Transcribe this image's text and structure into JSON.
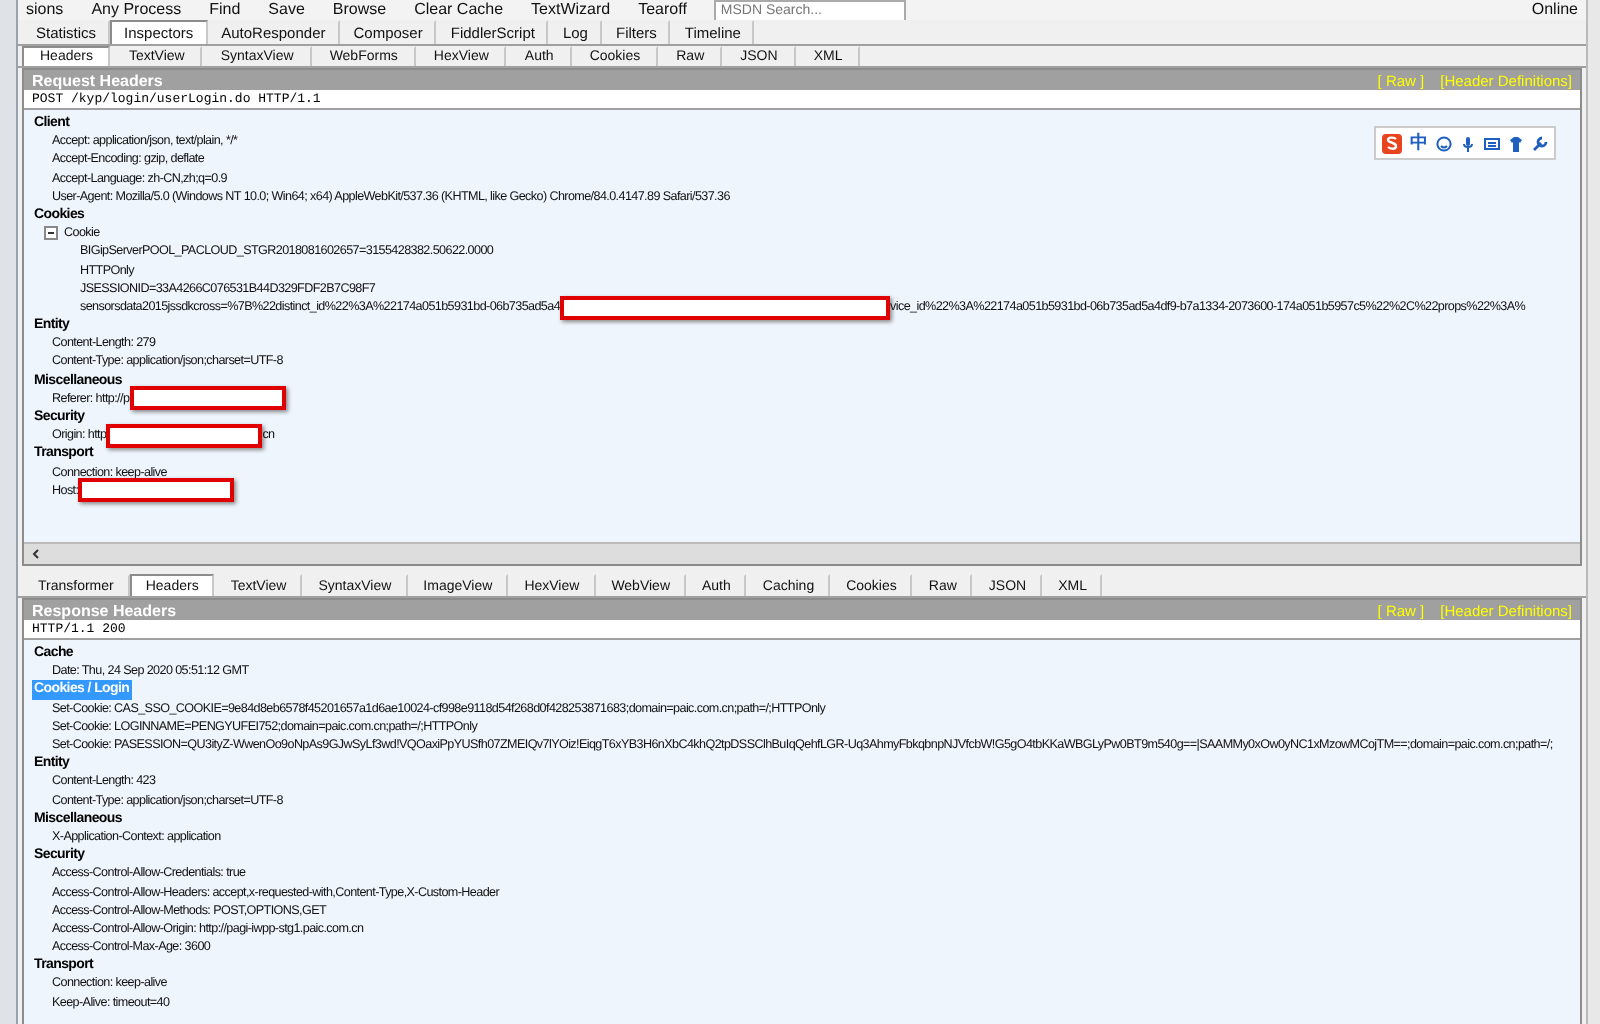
{
  "toolbar": [
    {
      "label": "sions"
    },
    {
      "label": "Any Process"
    },
    {
      "label": "Find"
    },
    {
      "label": "Save"
    },
    {
      "label": "Browse"
    },
    {
      "label": "Clear Cache"
    },
    {
      "label": "TextWizard"
    },
    {
      "label": "Tearoff"
    }
  ],
  "search": {
    "placeholder": "MSDN Search..."
  },
  "online": {
    "label": "Online"
  },
  "inspector_tabs": [
    {
      "label": "Statistics",
      "selected": false
    },
    {
      "label": "Inspectors",
      "selected": true
    },
    {
      "label": "AutoResponder",
      "selected": false
    },
    {
      "label": "Composer",
      "selected": false
    },
    {
      "label": "FiddlerScript",
      "selected": false
    },
    {
      "label": "Log",
      "selected": false
    },
    {
      "label": "Filters",
      "selected": false
    },
    {
      "label": "Timeline",
      "selected": false
    }
  ],
  "request": {
    "tabs": [
      {
        "label": "Headers",
        "selected": true
      },
      {
        "label": "TextView",
        "selected": false
      },
      {
        "label": "SyntaxView",
        "selected": false
      },
      {
        "label": "WebForms",
        "selected": false
      },
      {
        "label": "HexView",
        "selected": false
      },
      {
        "label": "Auth",
        "selected": false
      },
      {
        "label": "Cookies",
        "selected": false
      },
      {
        "label": "Raw",
        "selected": false
      },
      {
        "label": "JSON",
        "selected": false
      },
      {
        "label": "XML",
        "selected": false
      }
    ],
    "title": "Request Headers",
    "links": [
      "[ Raw ]",
      "[Header Definitions]"
    ],
    "status_line": "POST /kyp/login/userLogin.do HTTP/1.1",
    "ime_toolbar": {
      "label": "中"
    },
    "sections": [
      {
        "title": "Client",
        "selected": false,
        "lines": [
          {
            "parts": [
              {
                "kind": "text",
                "text": "Accept: application/json, text/plain, */*"
              }
            ]
          },
          {
            "parts": [
              {
                "kind": "text",
                "text": "Accept-Encoding: gzip, deflate"
              }
            ]
          },
          {
            "parts": [
              {
                "kind": "text",
                "text": "Accept-Language: zh-CN,zh;q=0.9"
              }
            ]
          },
          {
            "parts": [
              {
                "kind": "text",
                "text": "User-Agent: Mozilla/5.0 (Windows NT 10.0; Win64; x64) AppleWebKit/537.36 (KHTML, like Gecko) Chrome/84.0.4147.89 Safari/537.36"
              }
            ]
          }
        ]
      },
      {
        "title": "Cookies",
        "selected": false,
        "tree": {
          "label": "Cookie",
          "expanded": true,
          "children": [
            {
              "parts": [
                {
                  "kind": "text",
                  "text": "BIGipServerPOOL_PACLOUD_STGR2018081602657=3155428382.50622.0000"
                }
              ]
            },
            {
              "parts": [
                {
                  "kind": "text",
                  "text": "HTTPOnly"
                }
              ]
            },
            {
              "parts": [
                {
                  "kind": "text",
                  "text": "JSESSIONID=33A4266C076531B44D329FDF2B7C98F7"
                }
              ]
            },
            {
              "parts": [
                {
                  "kind": "text",
                  "text": "sensorsdata2015jssdkcross=%7B%22distinct_id%22%3A%22174a051b5931bd-06b735ad5a4"
                },
                {
                  "kind": "wide_redaction"
                },
                {
                  "kind": "text",
                  "text": "vice_id%22%3A%22174a051b5931bd-06b735ad5a4df9-b7a1334-2073600-174a051b5957c5%22%2C%22props%22%3A%"
                }
              ]
            }
          ]
        }
      },
      {
        "title": "Entity",
        "selected": false,
        "lines": [
          {
            "parts": [
              {
                "kind": "text",
                "text": "Content-Length: 279"
              }
            ]
          },
          {
            "parts": [
              {
                "kind": "text",
                "text": "Content-Type: application/json;charset=UTF-8"
              }
            ]
          }
        ]
      },
      {
        "title": "Miscellaneous",
        "selected": false,
        "lines": [
          {
            "parts": [
              {
                "kind": "text",
                "text": "Referer: http://p"
              },
              {
                "kind": "redaction"
              }
            ]
          }
        ]
      },
      {
        "title": "Security",
        "selected": false,
        "lines": [
          {
            "parts": [
              {
                "kind": "text",
                "text": "Origin: http"
              },
              {
                "kind": "redaction"
              },
              {
                "kind": "text",
                "text": "cn"
              }
            ]
          }
        ]
      },
      {
        "title": "Transport",
        "selected": false,
        "lines": [
          {
            "parts": [
              {
                "kind": "text",
                "text": "Connection: keep-alive"
              }
            ]
          },
          {
            "parts": [
              {
                "kind": "text",
                "text": "Host:"
              },
              {
                "kind": "redaction"
              }
            ]
          }
        ]
      }
    ]
  },
  "response": {
    "tabs": [
      {
        "label": "Transformer",
        "selected": false
      },
      {
        "label": "Headers",
        "selected": true
      },
      {
        "label": "TextView",
        "selected": false
      },
      {
        "label": "SyntaxView",
        "selected": false
      },
      {
        "label": "ImageView",
        "selected": false
      },
      {
        "label": "HexView",
        "selected": false
      },
      {
        "label": "WebView",
        "selected": false
      },
      {
        "label": "Auth",
        "selected": false
      },
      {
        "label": "Caching",
        "selected": false
      },
      {
        "label": "Cookies",
        "selected": false
      },
      {
        "label": "Raw",
        "selected": false
      },
      {
        "label": "JSON",
        "selected": false
      },
      {
        "label": "XML",
        "selected": false
      }
    ],
    "title": "Response Headers",
    "links": [
      "[ Raw ]",
      "[Header Definitions]"
    ],
    "status_line": "HTTP/1.1 200",
    "sections": [
      {
        "title": "Cache",
        "selected": false,
        "lines": [
          {
            "parts": [
              {
                "kind": "text",
                "text": "Date: Thu, 24 Sep 2020 05:51:12 GMT"
              }
            ]
          }
        ]
      },
      {
        "title": "Cookies / Login",
        "selected": true,
        "lines": [
          {
            "parts": [
              {
                "kind": "text",
                "text": "Set-Cookie: CAS_SSO_COOKIE=9e84d8eb6578f45201657a1d6ae10024-cf998e9118d54f268d0f428253871683;domain=paic.com.cn;path=/;HTTPOnly"
              }
            ]
          },
          {
            "parts": [
              {
                "kind": "text",
                "text": "Set-Cookie: LOGINNAME=PENGYUFEI752;domain=paic.com.cn;path=/;HTTPOnly"
              }
            ]
          },
          {
            "parts": [
              {
                "kind": "text",
                "text": "Set-Cookie: PASESSION=QU3ityZ-WwenOo9oNpAs9GJwSyLf3wd!VQOaxiPpYUSfh07ZMEIQv7lYOiz!EiqgT6xYB3H6nXbC4khQ2tpDSSClhBuIqQehfLGR-Uq3AhmyFbkqbnpNJVfcbW!G5gO4tbKKaWBGLyPw0BT9m540g==|SAAMMy0xOw0yNC1xMzowMCojTM==;domain=paic.com.cn;path=/;"
              }
            ]
          }
        ]
      },
      {
        "title": "Entity",
        "selected": false,
        "lines": [
          {
            "parts": [
              {
                "kind": "text",
                "text": "Content-Length: 423"
              }
            ]
          },
          {
            "parts": [
              {
                "kind": "text",
                "text": "Content-Type: application/json;charset=UTF-8"
              }
            ]
          }
        ]
      },
      {
        "title": "Miscellaneous",
        "selected": false,
        "lines": [
          {
            "parts": [
              {
                "kind": "text",
                "text": "X-Application-Context: application"
              }
            ]
          }
        ]
      },
      {
        "title": "Security",
        "selected": false,
        "lines": [
          {
            "parts": [
              {
                "kind": "text",
                "text": "Access-Control-Allow-Credentials: true"
              }
            ]
          },
          {
            "parts": [
              {
                "kind": "text",
                "text": "Access-Control-Allow-Headers: accept,x-requested-with,Content-Type,X-Custom-Header"
              }
            ]
          },
          {
            "parts": [
              {
                "kind": "text",
                "text": "Access-Control-Allow-Methods: POST,OPTIONS,GET"
              }
            ]
          },
          {
            "parts": [
              {
                "kind": "text",
                "text": "Access-Control-Allow-Origin: http://pagi-iwpp-stg1.paic.com.cn"
              }
            ]
          },
          {
            "parts": [
              {
                "kind": "text",
                "text": "Access-Control-Max-Age: 3600"
              }
            ]
          }
        ]
      },
      {
        "title": "Transport",
        "selected": false,
        "lines": [
          {
            "parts": [
              {
                "kind": "text",
                "text": "Connection: keep-alive"
              }
            ]
          },
          {
            "parts": [
              {
                "kind": "text",
                "text": "Keep-Alive: timeout=40"
              }
            ]
          }
        ]
      }
    ]
  }
}
